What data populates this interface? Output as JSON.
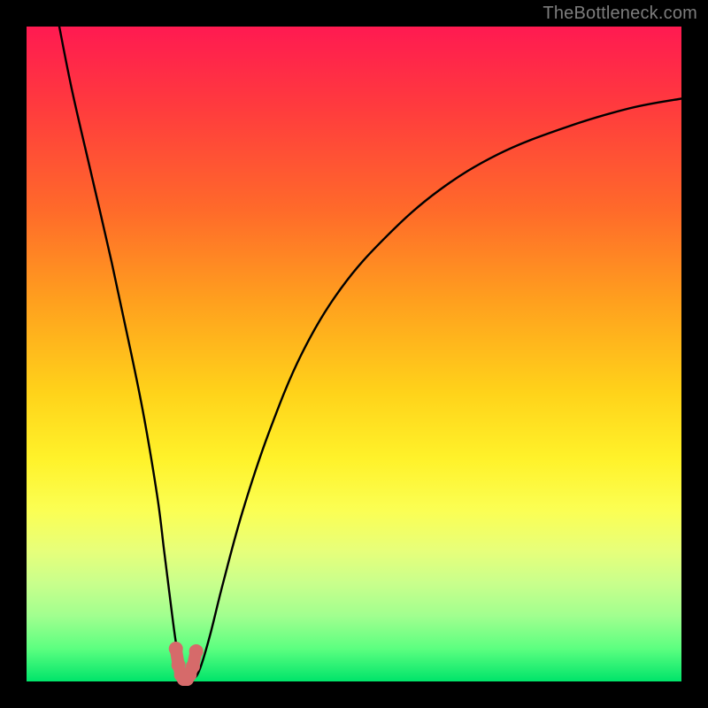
{
  "watermark": "TheBottleneck.com",
  "chart_data": {
    "type": "line",
    "title": "",
    "xlabel": "",
    "ylabel": "",
    "xlim": [
      0,
      100
    ],
    "ylim": [
      0,
      100
    ],
    "curve": {
      "x": [
        5,
        7,
        10,
        13,
        16,
        18,
        20,
        21,
        22,
        22.8,
        23.6,
        24.5,
        25.5,
        26.5,
        28,
        30,
        33,
        37,
        42,
        48,
        55,
        63,
        72,
        82,
        92,
        100
      ],
      "y": [
        100,
        90,
        77,
        64,
        50,
        40,
        28,
        20,
        12,
        6,
        2,
        0.4,
        0.4,
        2,
        7,
        15,
        26,
        38,
        50,
        60,
        68,
        75,
        80.5,
        84.5,
        87.5,
        89
      ]
    },
    "valley_marker": {
      "x": [
        22.8,
        23.2,
        23.6,
        24.0,
        24.5,
        24.9,
        25.4,
        25.9
      ],
      "y": [
        5.0,
        2.5,
        1.0,
        0.4,
        0.4,
        1.0,
        2.3,
        4.6
      ]
    },
    "marker_color": "#d66a6a"
  }
}
